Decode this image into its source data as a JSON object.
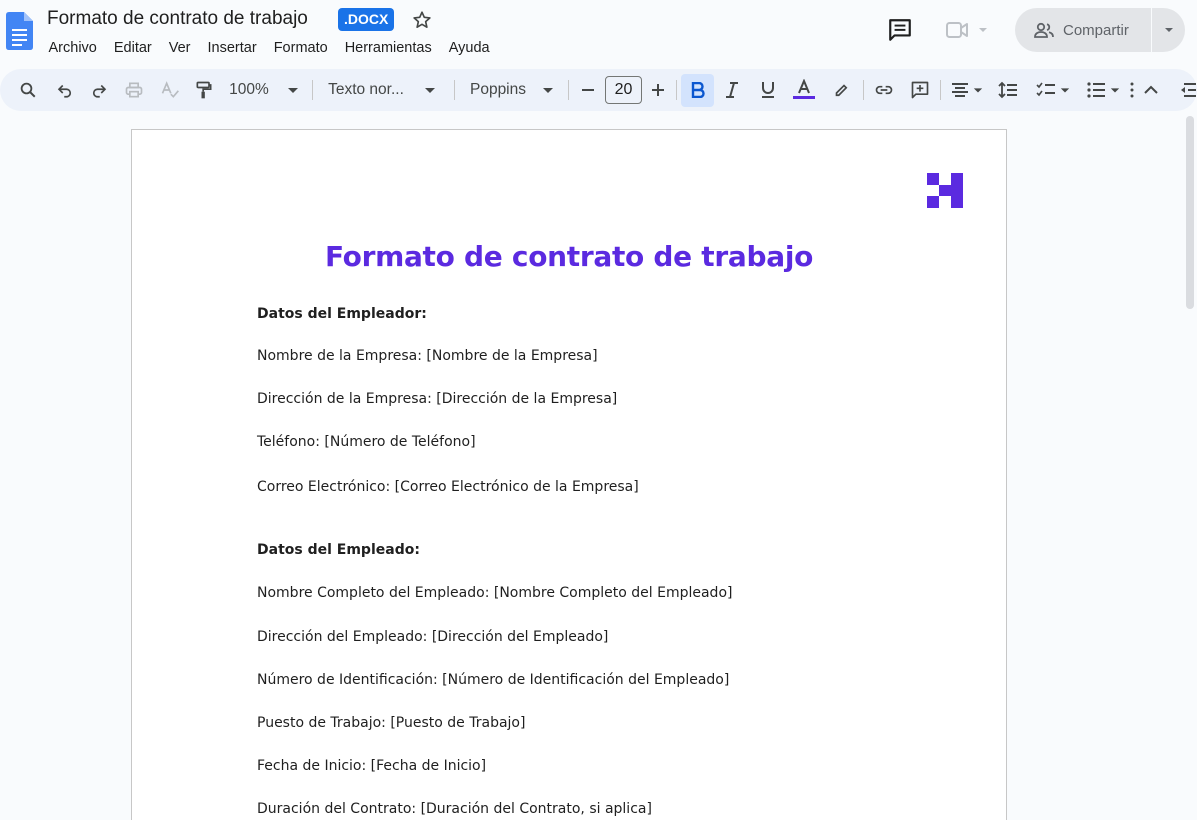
{
  "header": {
    "title": "Formato de contrato de trabajo",
    "badge": ".DOCX",
    "menu": [
      "Archivo",
      "Editar",
      "Ver",
      "Insertar",
      "Formato",
      "Herramientas",
      "Ayuda"
    ],
    "share_label": "Compartir"
  },
  "toolbar": {
    "zoom": "100%",
    "style": "Texto nor...",
    "font": "Poppins",
    "font_size": "20"
  },
  "document": {
    "title": "Formato de contrato de trabajo",
    "employer_heading": "Datos del Empleador:",
    "employer_lines": [
      "Nombre de la Empresa: [Nombre de la Empresa]",
      "Dirección de la Empresa: [Dirección de la Empresa]",
      "Teléfono: [Número de Teléfono]",
      "Correo Electrónico: [Correo Electrónico de la Empresa]"
    ],
    "employee_heading": "Datos del Empleado:",
    "employee_lines": [
      "Nombre Completo del Empleado: [Nombre Completo del Empleado]",
      "Dirección del Empleado: [Dirección del Empleado]",
      "Número de Identificación: [Número de Identificación del Empleado]",
      "Puesto de Trabajo: [Puesto de Trabajo]",
      "Fecha de Inicio: [Fecha de Inicio]",
      "Duración del Contrato: [Duración del Contrato, si aplica]"
    ]
  },
  "colors": {
    "accent": "#1a73e8",
    "title": "#5b2ae0",
    "toolbar_bg": "#edf2fa"
  }
}
